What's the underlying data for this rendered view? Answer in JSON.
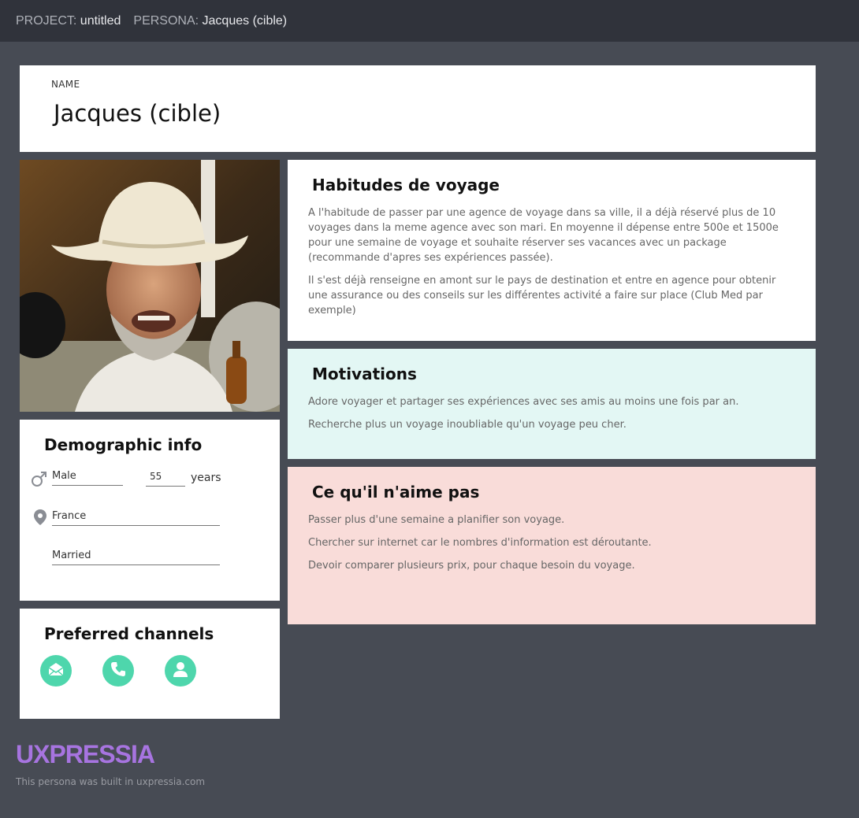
{
  "topbar": {
    "project_label": "PROJECT:",
    "project_value": "untitled",
    "persona_label": "PERSONA:",
    "persona_value": "Jacques (cible)"
  },
  "name_card": {
    "label": "NAME",
    "value": "Jacques (cible)"
  },
  "demographic": {
    "title": "Demographic info",
    "gender": "Male",
    "age": "55",
    "age_unit": "years",
    "location": "France",
    "status": "Married"
  },
  "channels": {
    "title": "Preferred channels",
    "items": [
      "email-icon",
      "phone-icon",
      "person-icon"
    ]
  },
  "habits": {
    "title": "Habitudes de voyage",
    "paragraphs": [
      "A l'habitude de passer par une agence de voyage dans sa ville, il a déjà réservé plus de 10 voyages dans la meme agence avec son mari. En moyenne il dépense entre 500e et 1500e pour une semaine de voyage  et souhaite réserver ses vacances avec un package (recommande d'apres ses expériences passée).",
      "Il s'est déjà renseigne en amont sur le pays de destination et entre en agence pour obtenir une assurance ou des conseils sur les différentes activité a faire sur place (Club Med par exemple)"
    ]
  },
  "motivations": {
    "title": "Motivations",
    "paragraphs": [
      "Adore voyager et partager ses expériences avec ses amis au moins une fois par an.",
      "Recherche plus un voyage inoubliable qu'un voyage peu cher."
    ]
  },
  "dislikes": {
    "title": "Ce qu'il n'aime pas",
    "paragraphs": [
      "Passer plus d'une semaine a planifier son voyage.",
      "Chercher sur internet car le nombres d'information est déroutante.",
      "Devoir comparer plusieurs prix, pour chaque besoin du voyage."
    ]
  },
  "footer": {
    "logo": "UXPRESSIA",
    "credit": "This persona was built in uxpressia.com"
  },
  "colors": {
    "accent": "#4ed6ac",
    "logo": "#a774e0",
    "motivations_bg": "#e3f7f4",
    "dislikes_bg": "#f9dcd9"
  }
}
